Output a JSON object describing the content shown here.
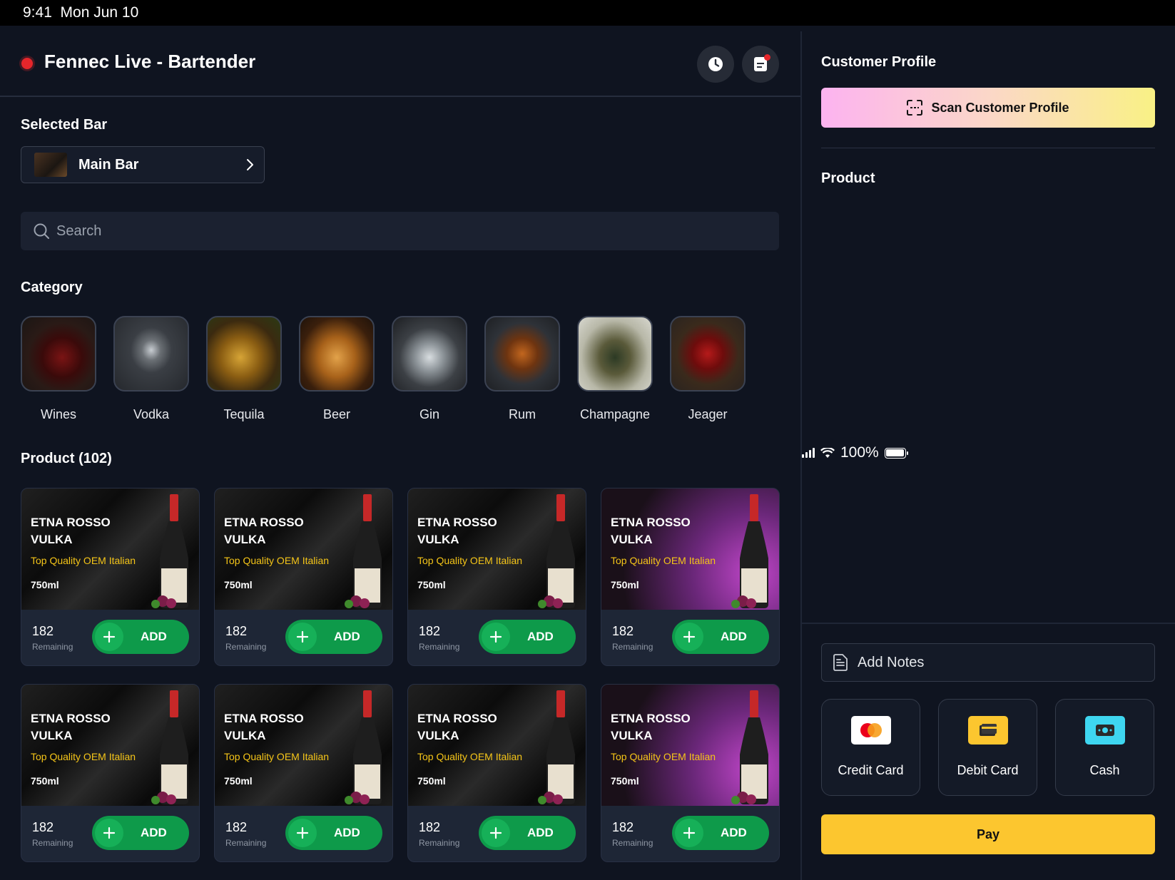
{
  "status_bar": {
    "time": "9:41",
    "date": "Mon Jun 10",
    "battery": "100%"
  },
  "header": {
    "title": "Fennec Live - Bartender"
  },
  "selected_bar": {
    "label": "Selected Bar",
    "name": "Main Bar"
  },
  "search": {
    "placeholder": "Search"
  },
  "category": {
    "label": "Category",
    "items": [
      {
        "label": "Wines"
      },
      {
        "label": "Vodka"
      },
      {
        "label": "Tequila"
      },
      {
        "label": "Beer"
      },
      {
        "label": "Gin"
      },
      {
        "label": "Rum"
      },
      {
        "label": "Champagne"
      },
      {
        "label": "Jeager"
      }
    ]
  },
  "products": {
    "label": "Product (102)",
    "add_label": "ADD",
    "remaining_label": "Remaining",
    "items": [
      {
        "name": "ETNA ROSSO VULKA",
        "tagline": "Top Quality OEM Italian",
        "size": "750ml",
        "stock": "182"
      },
      {
        "name": "ETNA ROSSO VULKA",
        "tagline": "Top Quality OEM Italian",
        "size": "750ml",
        "stock": "182"
      },
      {
        "name": "ETNA ROSSO VULKA",
        "tagline": "Top Quality OEM Italian",
        "size": "750ml",
        "stock": "182"
      },
      {
        "name": "ETNA ROSSO VULKA",
        "tagline": "Top Quality OEM Italian",
        "size": "750ml",
        "stock": "182"
      },
      {
        "name": "ETNA ROSSO VULKA",
        "tagline": "Top Quality OEM Italian",
        "size": "750ml",
        "stock": "182"
      },
      {
        "name": "ETNA ROSSO VULKA",
        "tagline": "Top Quality OEM Italian",
        "size": "750ml",
        "stock": "182"
      },
      {
        "name": "ETNA ROSSO VULKA",
        "tagline": "Top Quality OEM Italian",
        "size": "750ml",
        "stock": "182"
      },
      {
        "name": "ETNA ROSSO VULKA",
        "tagline": "Top Quality OEM Italian",
        "size": "750ml",
        "stock": "182"
      }
    ]
  },
  "customer_panel": {
    "title": "Customer Profile",
    "scan_label": "Scan Customer Profile",
    "product_label": "Product",
    "notes_placeholder": "Add Notes",
    "payment_methods": [
      {
        "label": "Credit Card"
      },
      {
        "label": "Debit Card"
      },
      {
        "label": "Cash"
      }
    ],
    "pay_label": "Pay"
  },
  "colors": {
    "background": "#0f1420",
    "accent_green": "#0e9a4a",
    "accent_yellow": "#fcc62f",
    "live_red": "#e5262b",
    "tag_yellow": "#f5c518"
  }
}
